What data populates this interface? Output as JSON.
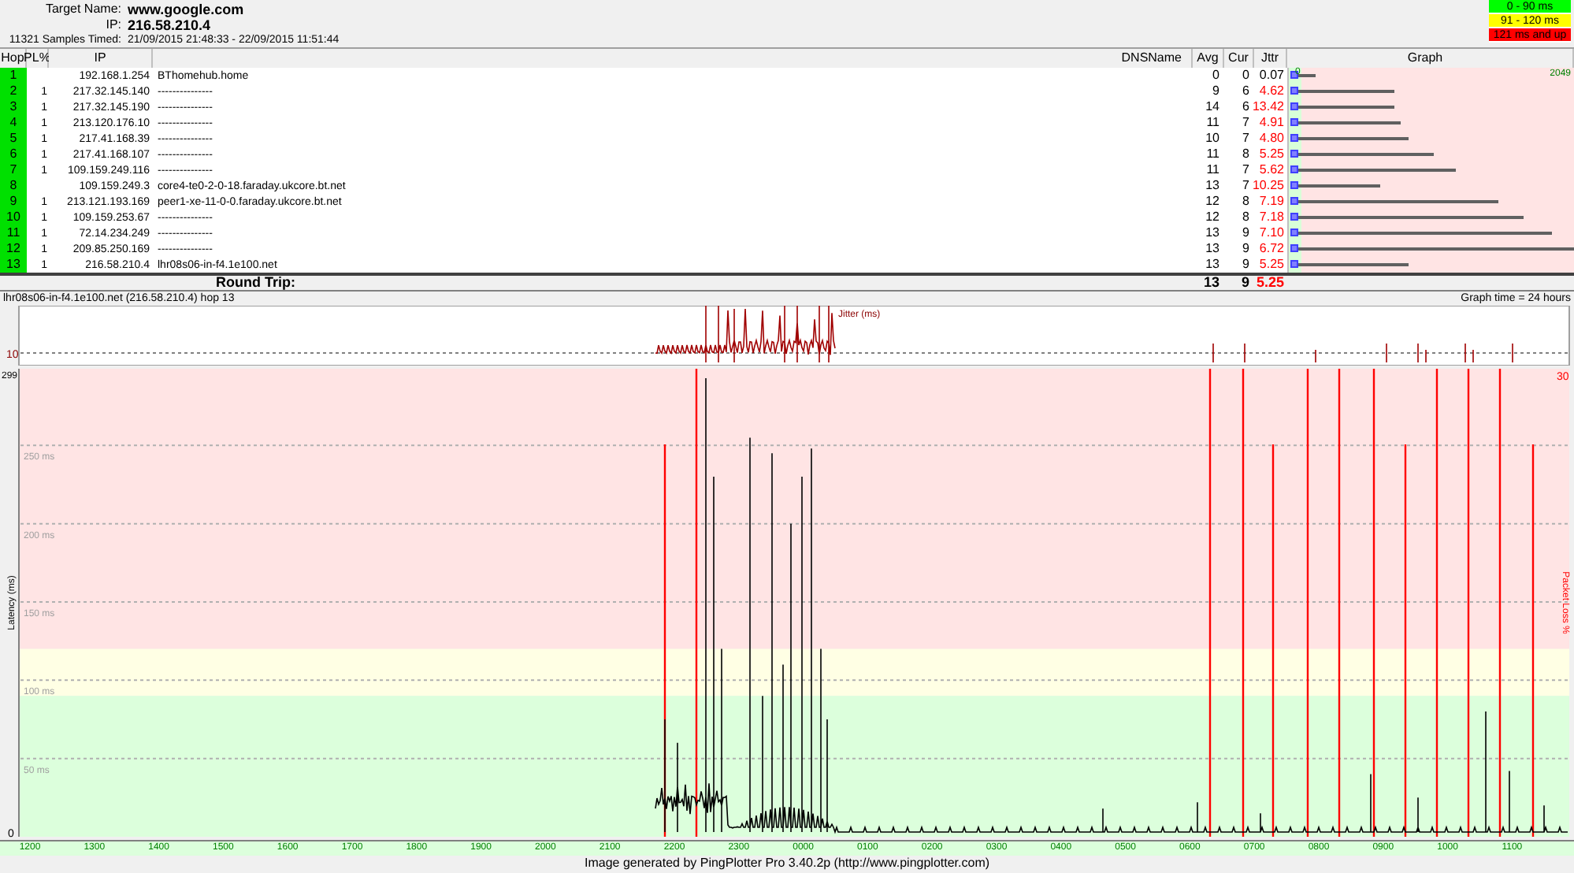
{
  "header": {
    "target_label": "Target Name:",
    "target": "www.google.com",
    "ip_label": "IP:",
    "ip": "216.58.210.4",
    "samples_label": "11321 Samples Timed:",
    "samples_range": "21/09/2015 21:48:33 - 22/09/2015 11:51:44"
  },
  "legend": [
    {
      "label": "0 - 90 ms",
      "color": "#00ff00"
    },
    {
      "label": "91 - 120 ms",
      "color": "#ffff00"
    },
    {
      "label": "121 ms and up",
      "color": "#ff0000"
    }
  ],
  "table": {
    "columns": [
      "Hop",
      "PL%",
      "IP",
      "DNSName",
      "Avg",
      "Cur",
      "Jttr",
      "Graph"
    ],
    "graph_min": "0",
    "graph_max": "2049",
    "rows": [
      {
        "hop": "1",
        "ip": "192.168.1.254",
        "dns": "BThomehub.home",
        "avg": "0",
        "cur": "0",
        "jitter": "0.07",
        "jitter_high": false,
        "level": 0.08
      },
      {
        "hop": "2",
        "pl": "1",
        "ip": "217.32.145.140",
        "dns": "---------------",
        "avg": "9",
        "cur": "6",
        "jitter": "4.62",
        "jitter_high": true,
        "level": 0.36
      },
      {
        "hop": "3",
        "pl": "1",
        "ip": "217.32.145.190",
        "dns": "---------------",
        "avg": "14",
        "cur": "6",
        "jitter": "13.42",
        "jitter_high": true,
        "level": 0.36
      },
      {
        "hop": "4",
        "pl": "1",
        "ip": "213.120.176.10",
        "dns": "---------------",
        "avg": "11",
        "cur": "7",
        "jitter": "4.91",
        "jitter_high": true,
        "level": 0.38
      },
      {
        "hop": "5",
        "pl": "1",
        "ip": "217.41.168.39",
        "dns": "---------------",
        "avg": "10",
        "cur": "7",
        "jitter": "4.80",
        "jitter_high": true,
        "level": 0.41
      },
      {
        "hop": "6",
        "pl": "1",
        "ip": "217.41.168.107",
        "dns": "---------------",
        "avg": "11",
        "cur": "8",
        "jitter": "5.25",
        "jitter_high": true,
        "level": 0.5
      },
      {
        "hop": "7",
        "pl": "1",
        "ip": "109.159.249.116",
        "dns": "---------------",
        "avg": "11",
        "cur": "7",
        "jitter": "5.62",
        "jitter_high": true,
        "level": 0.58
      },
      {
        "hop": "8",
        "ip": "109.159.249.3",
        "dns": "core4-te0-2-0-18.faraday.ukcore.bt.net",
        "avg": "13",
        "cur": "7",
        "jitter": "10.25",
        "jitter_high": true,
        "level": 0.31
      },
      {
        "hop": "9",
        "pl": "1",
        "ip": "213.121.193.169",
        "dns": "peer1-xe-11-0-0.faraday.ukcore.bt.net",
        "avg": "12",
        "cur": "8",
        "jitter": "7.19",
        "jitter_high": true,
        "level": 0.73
      },
      {
        "hop": "10",
        "pl": "1",
        "ip": "109.159.253.67",
        "dns": "---------------",
        "avg": "12",
        "cur": "8",
        "jitter": "7.18",
        "jitter_high": true,
        "level": 0.82
      },
      {
        "hop": "11",
        "pl": "1",
        "ip": "72.14.234.249",
        "dns": "---------------",
        "avg": "13",
        "cur": "9",
        "jitter": "7.10",
        "jitter_high": true,
        "level": 0.92
      },
      {
        "hop": "12",
        "pl": "1",
        "ip": "209.85.250.169",
        "dns": "---------------",
        "avg": "13",
        "cur": "9",
        "jitter": "6.72",
        "jitter_high": true,
        "level": 1.0
      },
      {
        "hop": "13",
        "pl": "1",
        "ip": "216.58.210.4",
        "dns": "lhr08s06-in-f4.1e100.net",
        "avg": "13",
        "cur": "9",
        "jitter": "5.25",
        "jitter_high": true,
        "level": 0.41
      }
    ],
    "round_trip": {
      "label": "Round Trip:",
      "avg": "13",
      "cur": "9",
      "jitter": "5.25"
    }
  },
  "graph": {
    "title": "lhr08s06-in-f4.1e100.net (216.58.210.4) hop 13",
    "time_span": "Graph time = 24 hours",
    "jitter_label": "Jitter (ms)",
    "jitter_tick": "10",
    "y_max": "299",
    "y_min": "0",
    "y_labels": [
      "250 ms",
      "200 ms",
      "150 ms",
      "100 ms",
      "50 ms"
    ],
    "y_axis_label": "Latency (ms)",
    "loss_max": "30",
    "loss_axis_label": "Packet Loss %",
    "x_labels": [
      "1200",
      "1300",
      "1400",
      "1500",
      "1600",
      "1700",
      "1800",
      "1900",
      "2000",
      "2100",
      "2200",
      "2300",
      "0000",
      "0100",
      "0200",
      "0300",
      "0400",
      "0500",
      "0600",
      "0700",
      "0800",
      "0900",
      "1000",
      "1100"
    ]
  },
  "footer": "Image generated by PingPlotter Pro 3.40.2p (http://www.pingplotter.com)"
}
